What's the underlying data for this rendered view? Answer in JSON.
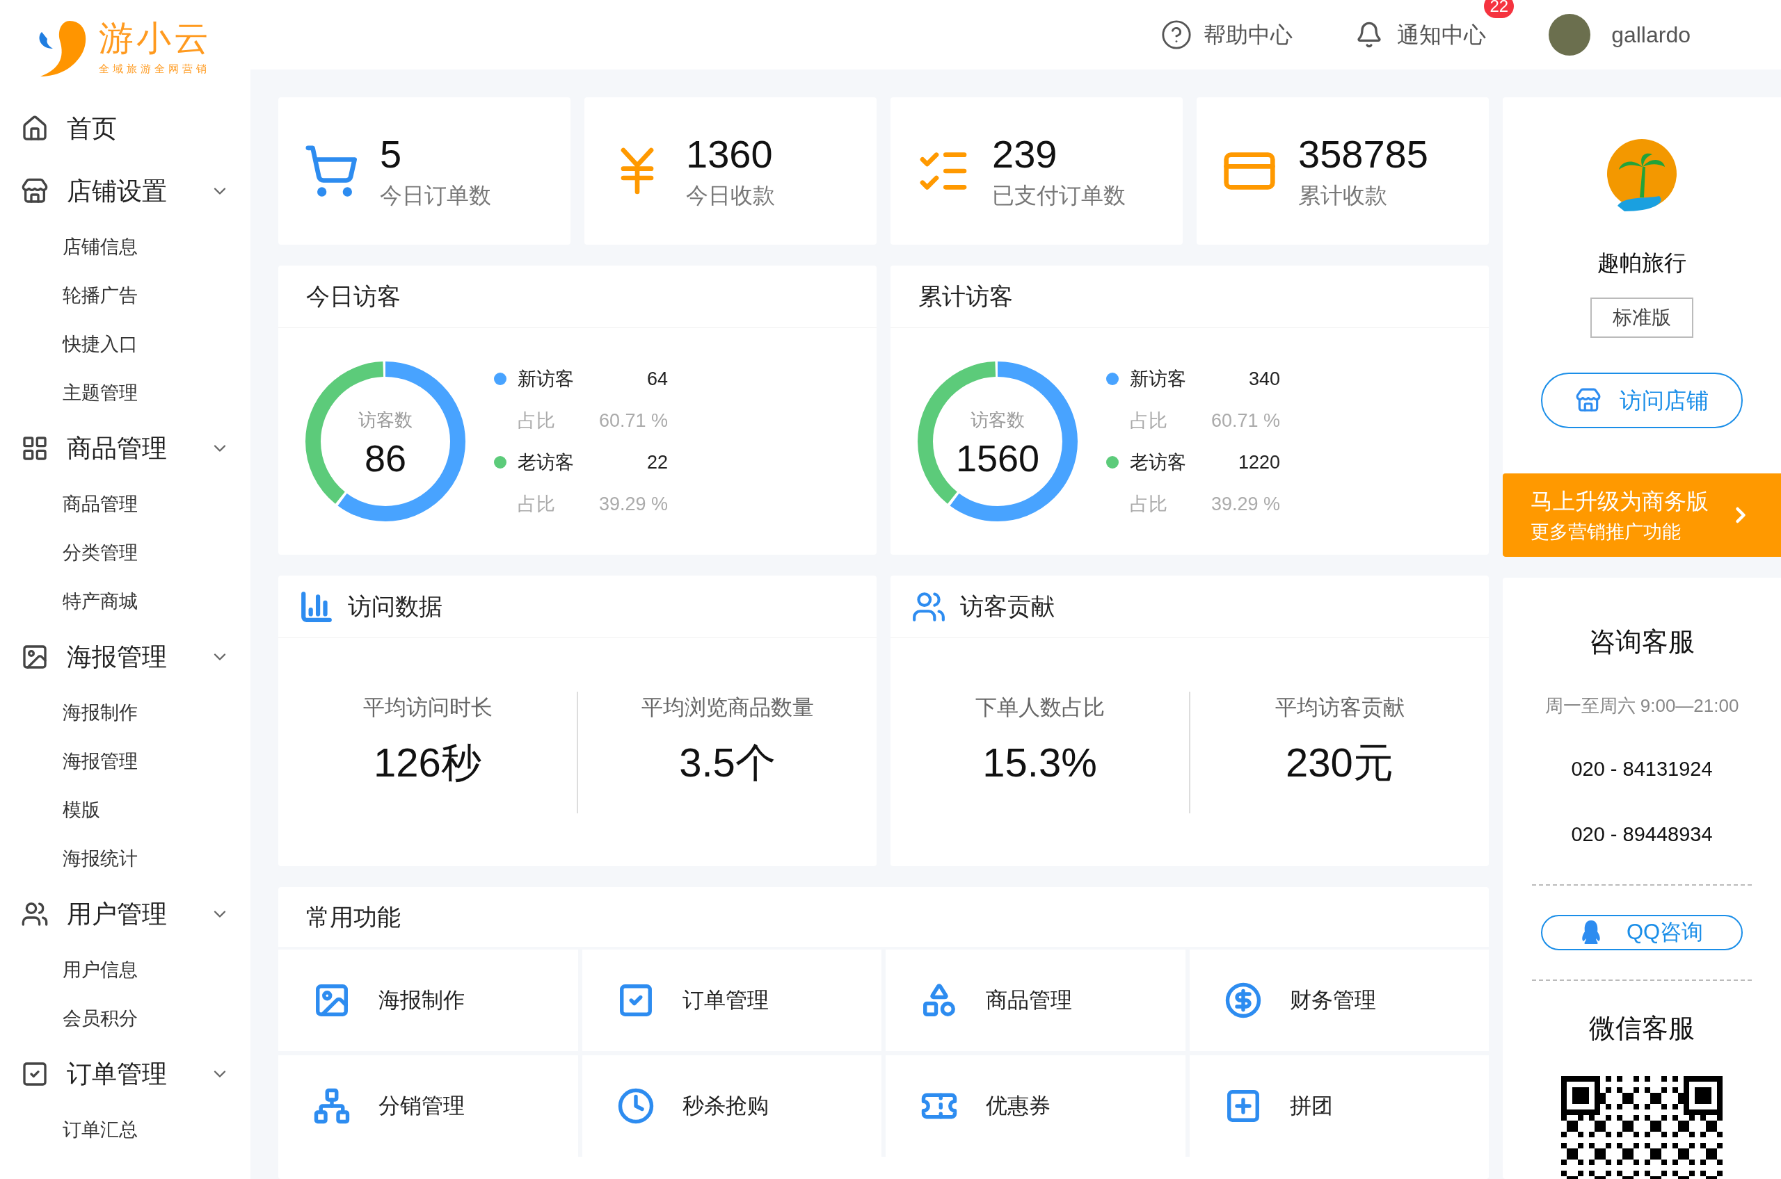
{
  "logo": {
    "name": "游小云",
    "slogan": "全域旅游全网营销"
  },
  "header": {
    "help": "帮助中心",
    "notifications": "通知中心",
    "notification_count": "22",
    "user": "gallardo"
  },
  "sidebar": {
    "items": [
      {
        "label": "首页"
      },
      {
        "label": "店铺设置",
        "expanded": true,
        "children": [
          {
            "label": "店铺信息"
          },
          {
            "label": "轮播广告"
          },
          {
            "label": "快捷入口"
          },
          {
            "label": "主题管理"
          }
        ]
      },
      {
        "label": "商品管理",
        "expanded": true,
        "children": [
          {
            "label": "商品管理"
          },
          {
            "label": "分类管理"
          },
          {
            "label": "特产商城"
          }
        ]
      },
      {
        "label": "海报管理",
        "expanded": true,
        "children": [
          {
            "label": "海报制作"
          },
          {
            "label": "海报管理"
          },
          {
            "label": "模版"
          },
          {
            "label": "海报统计"
          }
        ]
      },
      {
        "label": "用户管理",
        "expanded": true,
        "children": [
          {
            "label": "用户信息"
          },
          {
            "label": "会员积分"
          }
        ]
      },
      {
        "label": "订单管理",
        "expanded": true,
        "children": [
          {
            "label": "订单汇总"
          }
        ]
      }
    ]
  },
  "stats": [
    {
      "value": "5",
      "label": "今日订单数"
    },
    {
      "value": "1360",
      "label": "今日收款"
    },
    {
      "value": "239",
      "label": "已支付订单数"
    },
    {
      "value": "358785",
      "label": "累计收款"
    }
  ],
  "visitor_cards": [
    {
      "title": "今日访客",
      "center_label": "访客数",
      "center_value": "86",
      "legend": [
        {
          "name": "新访客",
          "value": "64",
          "share_label": "占比",
          "share": "60.71 %",
          "color": "#48a3ff"
        },
        {
          "name": "老访客",
          "value": "22",
          "share_label": "占比",
          "share": "39.29 %",
          "color": "#5ccb7a"
        }
      ]
    },
    {
      "title": "累计访客",
      "center_label": "访客数",
      "center_value": "1560",
      "legend": [
        {
          "name": "新访客",
          "value": "340",
          "share_label": "占比",
          "share": "60.71 %",
          "color": "#48a3ff"
        },
        {
          "name": "老访客",
          "value": "1220",
          "share_label": "占比",
          "share": "39.29 %",
          "color": "#5ccb7a"
        }
      ]
    }
  ],
  "metric_cards": [
    {
      "title": "访问数据",
      "metrics": [
        {
          "label": "平均访问时长",
          "value": "126秒"
        },
        {
          "label": "平均浏览商品数量",
          "value": "3.5个"
        }
      ]
    },
    {
      "title": "访客贡献",
      "metrics": [
        {
          "label": "下单人数占比",
          "value": "15.3%"
        },
        {
          "label": "平均访客贡献",
          "value": "230元"
        }
      ]
    }
  ],
  "functions": {
    "title": "常用功能",
    "items": [
      {
        "label": "海报制作"
      },
      {
        "label": "订单管理"
      },
      {
        "label": "商品管理"
      },
      {
        "label": "财务管理"
      },
      {
        "label": "分销管理"
      },
      {
        "label": "秒杀抢购"
      },
      {
        "label": "优惠券"
      },
      {
        "label": "拼团"
      }
    ]
  },
  "shop": {
    "name": "趣帕旅行",
    "edition": "标准版",
    "visit_button": "访问店铺",
    "upgrade_title": "马上升级为商务版",
    "upgrade_subtitle": "更多营销推广功能"
  },
  "support": {
    "title": "咨询客服",
    "hours": "周一至周六  9:00—21:00",
    "phones": [
      "020 - 84131924",
      "020 - 89448934"
    ],
    "qq_button": "QQ咨询",
    "wechat_title": "微信客服"
  }
}
